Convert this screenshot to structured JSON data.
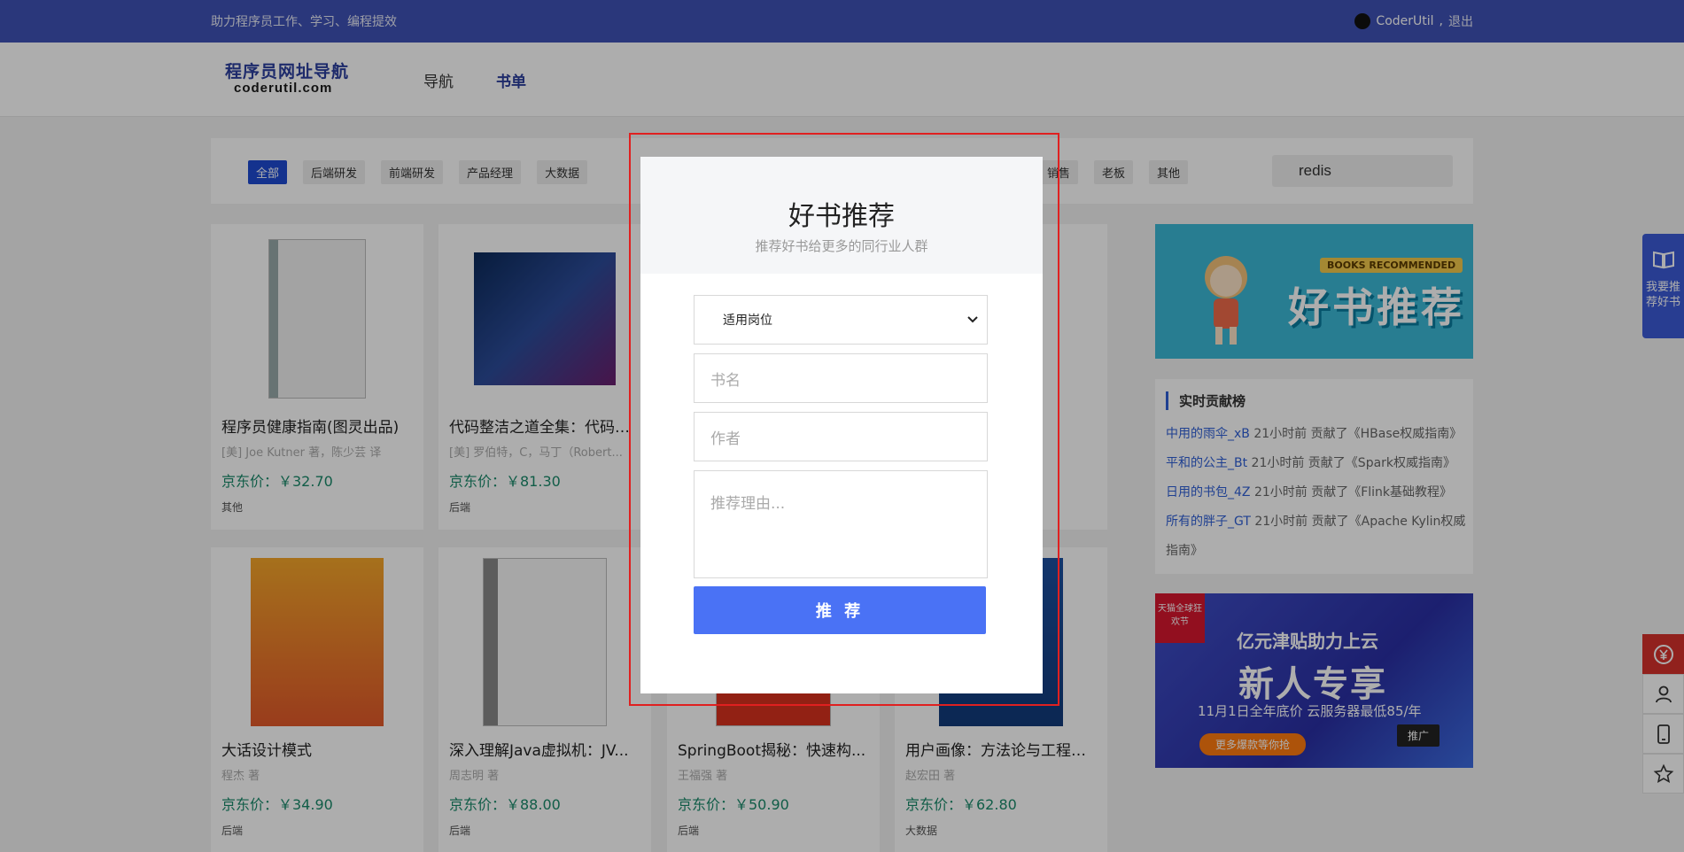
{
  "topbar": {
    "slogan": "助力程序员工作、学习、编程提效",
    "username": "CoderUtil",
    "separator": ",",
    "logout": "退出"
  },
  "header": {
    "logo_line1": "程序员网址导航",
    "logo_line2": "coderutil.com",
    "nav": [
      {
        "label": "导航"
      },
      {
        "label": "书单"
      }
    ]
  },
  "filters": {
    "tags": [
      "全部",
      "后端研发",
      "前端研发",
      "产品经理",
      "大数据"
    ],
    "tags_right": [
      "销售",
      "老板",
      "其他"
    ],
    "search_value": "redis"
  },
  "books": [
    {
      "title": "程序员健康指南(图灵出品)",
      "author": "[美] Joe Kutner 著，陈少芸 译",
      "price": "京东价：￥32.70",
      "category": "其他"
    },
    {
      "title": "代码整洁之道全集：代码整...",
      "author": "[美] 罗伯特，C，马丁（Robert...",
      "price": "京东价：￥81.30",
      "category": "后端"
    },
    {
      "title": "大话设计模式",
      "author": "程杰 著",
      "price": "京东价：￥34.90",
      "category": "后端"
    },
    {
      "title": "深入理解Java虚拟机：JV...",
      "author": "周志明 著",
      "price": "京东价：￥88.00",
      "category": "后端"
    },
    {
      "title": "SpringBoot揭秘：快速构...",
      "author": "王福强 著",
      "price": "京东价：￥50.90",
      "category": "后端"
    },
    {
      "title": "用户画像：方法论与工程化...",
      "author": "赵宏田 著",
      "price": "京东价：￥62.80",
      "category": "大数据"
    }
  ],
  "sidebar": {
    "banner1_title": "好书推荐",
    "banner1_tag": "BOOKS RECOMMENDED",
    "contrib_title": "实时贡献榜",
    "contrib": [
      {
        "user": "中用的雨伞_xB",
        "text": " 21小时前 贡献了《HBase权威指南》"
      },
      {
        "user": "平和的公主_Bt",
        "text": " 21小时前 贡献了《Spark权威指南》"
      },
      {
        "user": "日用的书包_4Z",
        "text": " 21小时前 贡献了《Flink基础教程》"
      },
      {
        "user": "所有的胖子_GT",
        "text": " 21小时前 贡献了《Apache Kylin权威指南》"
      }
    ],
    "banner2": {
      "line1": "亿元津贴助力上云",
      "line2": "新人专享",
      "line3": "11月1日全年底价 云服务器最低85/年",
      "cta": "更多爆款等你抢",
      "ad": "推广",
      "badge": "天猫全球狂欢节"
    }
  },
  "float": {
    "recommend_label": "我要推荐好书"
  },
  "modal": {
    "title": "好书推荐",
    "subtitle": "推荐好书给更多的同行业人群",
    "select_value": "适用岗位",
    "book_name_placeholder": "书名",
    "author_placeholder": "作者",
    "reason_placeholder": "推荐理由...",
    "submit_label": "推 荐"
  }
}
